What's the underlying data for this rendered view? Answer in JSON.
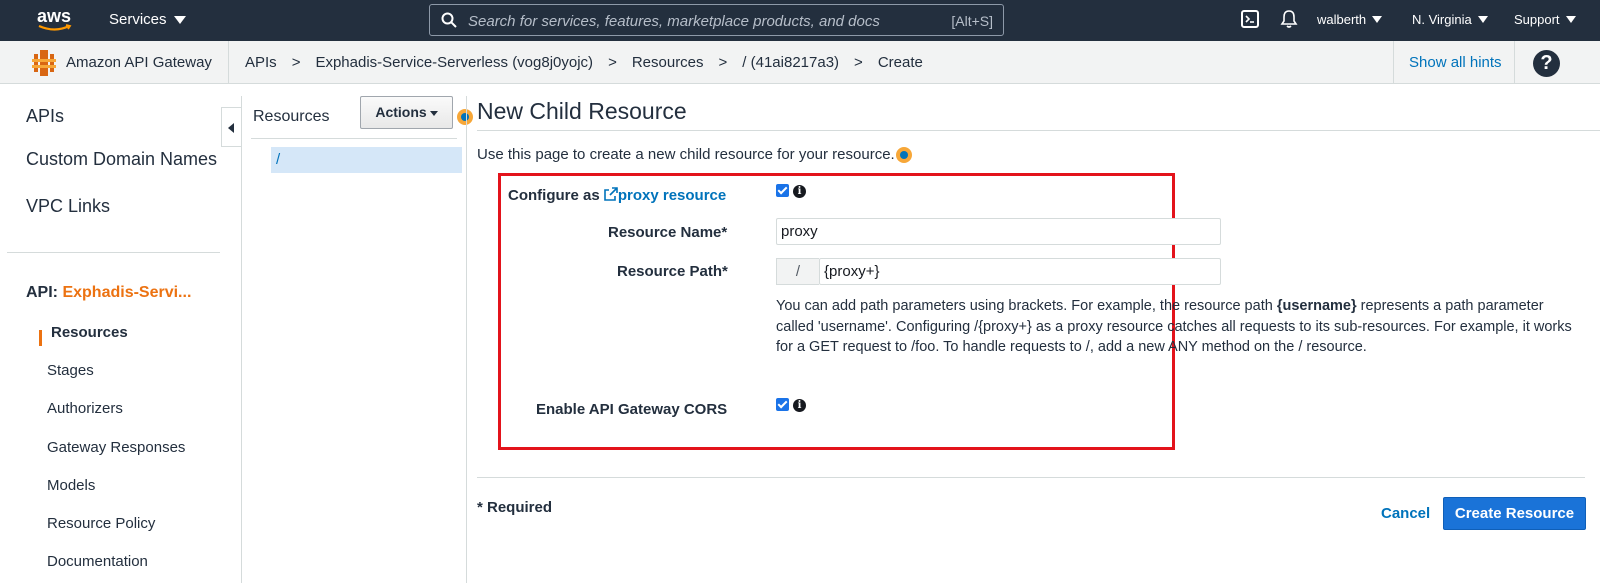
{
  "topnav": {
    "logo_text": "aws",
    "services_label": "Services",
    "search_placeholder": "Search for services, features, marketplace products, and docs",
    "search_shortcut": "[Alt+S]",
    "user": "walberth",
    "region": "N. Virginia",
    "support": "Support"
  },
  "breadcrumb_bar": {
    "service_name": "Amazon API Gateway",
    "crumbs": [
      "APIs",
      "Exphadis-Service-Serverless (vog8j0yojc)",
      "Resources",
      "/ (41ai8217a3)",
      "Create"
    ],
    "separator": ">",
    "show_hints": "Show all hints",
    "help": "?"
  },
  "sidebar": {
    "top_items": [
      "APIs",
      "Custom Domain Names",
      "VPC Links"
    ],
    "api_label": "API:",
    "api_name": "Exphadis-Servi...",
    "sub_items": [
      "Resources",
      "Stages",
      "Authorizers",
      "Gateway Responses",
      "Models",
      "Resource Policy",
      "Documentation"
    ]
  },
  "resources_panel": {
    "title": "Resources",
    "actions_label": "Actions",
    "tree": [
      "/"
    ]
  },
  "main": {
    "title": "New Child Resource",
    "description": "Use this page to create a new child resource for your resource.",
    "form": {
      "configure_as_prefix": "Configure as",
      "proxy_link": "proxy resource",
      "configure_checked": true,
      "resource_name_label": "Resource Name*",
      "resource_name_value": "proxy",
      "resource_path_label": "Resource Path*",
      "resource_path_prefix": "/",
      "resource_path_value": "{proxy+}",
      "help_part1": "You can add path parameters using brackets. For example, the resource path ",
      "help_bold": "{username}",
      "help_part2": " represents a path parameter called 'username'. Configuring /{proxy+} as a proxy resource catches all requests to its sub-resources. For example, it works for a GET request to /foo. To handle requests to /, add a new ANY method on the / resource.",
      "cors_label": "Enable API Gateway CORS",
      "cors_checked": true
    },
    "required_note": "* Required",
    "cancel_label": "Cancel",
    "create_label": "Create Resource"
  },
  "colors": {
    "nav_bg": "#232f3e",
    "accent_orange": "#ec7211",
    "link_blue": "#0073bb",
    "primary_button": "#1a73d8",
    "highlight_box": "#e3131b"
  }
}
